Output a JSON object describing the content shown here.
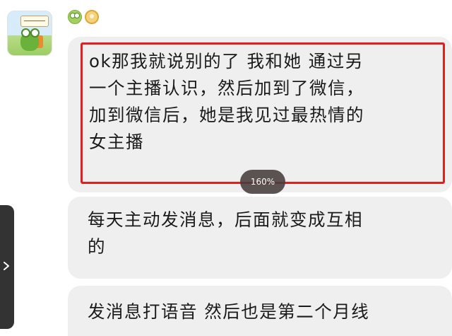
{
  "chat": {
    "sender": {
      "avatar_icon": "frog-avatar-icon",
      "badges": [
        "frog-badge-icon",
        "medal-badge-icon"
      ]
    },
    "messages": [
      {
        "text": "ok那我就说别的了 我和她 通过另\n一个主播认识，然后加到了微信，\n加到微信后，她是我见过最热情的\n女主播",
        "highlighted": true,
        "highlight_color": "#e0201f"
      },
      {
        "text": "每天主动发消息，后面就变成互相\n的",
        "highlighted": false
      },
      {
        "text": "发消息打语音 然后也是第二个月线",
        "highlighted": false
      }
    ]
  },
  "zoom_indicator": {
    "label": "160%"
  },
  "side_handle": {
    "icon": "chevron-right-icon"
  },
  "colors": {
    "bubble_bg": "#efefef",
    "highlight": "#e0201f",
    "text": "#1a1a1a"
  }
}
